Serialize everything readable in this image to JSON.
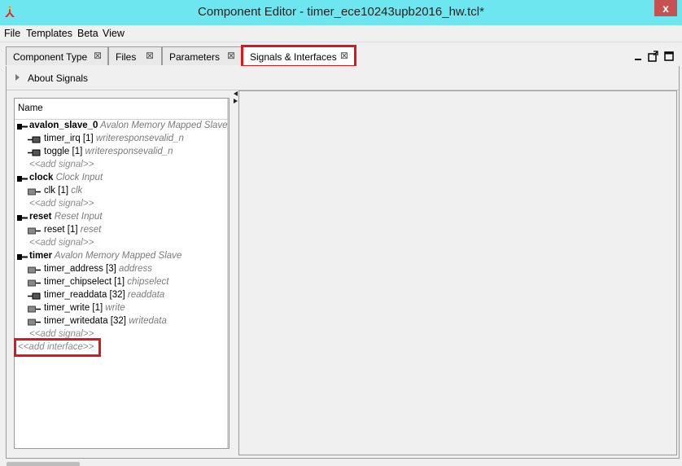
{
  "window": {
    "title": "Component Editor - timer_ece10243upb2016_hw.tcl*",
    "close_glyph": "x"
  },
  "menu": [
    {
      "label": "File"
    },
    {
      "label": "Templates"
    },
    {
      "label": "Beta"
    },
    {
      "label": "View"
    }
  ],
  "tabs": [
    {
      "label": "Component Type",
      "active": false
    },
    {
      "label": "Files",
      "active": false
    },
    {
      "label": "Parameters",
      "active": false
    },
    {
      "label": "Signals & Interfaces",
      "active": true
    }
  ],
  "tab_close_glyph": "⊠",
  "about_signals": "About Signals",
  "tree": {
    "header": "Name",
    "items": [
      {
        "kind": "interface",
        "name": "avalon_slave_0",
        "desc": "Avalon Memory Mapped Slave"
      },
      {
        "kind": "signal",
        "name": "timer_irq [1]",
        "desc": "writeresponsevalid_n",
        "dir": "in"
      },
      {
        "kind": "signal",
        "name": "toggle [1]",
        "desc": "writeresponsevalid_n",
        "dir": "in"
      },
      {
        "kind": "add",
        "name": "<<add signal>>"
      },
      {
        "kind": "interface",
        "name": "clock",
        "desc": "Clock Input"
      },
      {
        "kind": "signal",
        "name": "clk [1]",
        "desc": "clk",
        "dir": "out"
      },
      {
        "kind": "add",
        "name": "<<add signal>>"
      },
      {
        "kind": "interface",
        "name": "reset",
        "desc": "Reset Input"
      },
      {
        "kind": "signal",
        "name": "reset [1]",
        "desc": "reset",
        "dir": "out"
      },
      {
        "kind": "add",
        "name": "<<add signal>>"
      },
      {
        "kind": "interface",
        "name": "timer",
        "desc": "Avalon Memory Mapped Slave"
      },
      {
        "kind": "signal",
        "name": "timer_address [3]",
        "desc": "address",
        "dir": "out"
      },
      {
        "kind": "signal",
        "name": "timer_chipselect [1]",
        "desc": "chipselect",
        "dir": "out"
      },
      {
        "kind": "signal",
        "name": "timer_readdata [32]",
        "desc": "readdata",
        "dir": "in"
      },
      {
        "kind": "signal",
        "name": "timer_write [1]",
        "desc": "write",
        "dir": "out"
      },
      {
        "kind": "signal",
        "name": "timer_writedata [32]",
        "desc": "writedata",
        "dir": "out"
      },
      {
        "kind": "add",
        "name": "<<add signal>>"
      }
    ],
    "add_interface": "<<add interface>>"
  },
  "colors": {
    "titlebar": "#6ee6f0",
    "highlight": "#e0161b",
    "close": "#c75050"
  }
}
